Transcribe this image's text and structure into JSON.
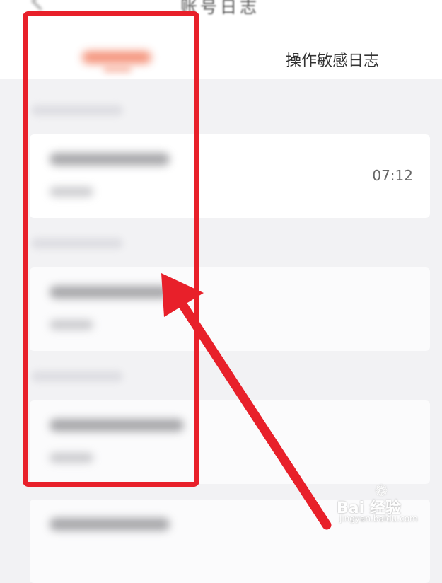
{
  "header": {
    "title": "账号日志",
    "tabs": [
      {
        "label": "",
        "active": true
      },
      {
        "label": "操作敏感日志",
        "active": false
      }
    ]
  },
  "entries": [
    {
      "time": "07:12"
    },
    {
      "time": ""
    },
    {
      "time": ""
    },
    {
      "time": ""
    }
  ],
  "watermark": {
    "brand": "Bai 经验",
    "url": "jingyan.baidu.com",
    "icon": "paw-icon"
  },
  "colors": {
    "accent": "#f27a5c",
    "annotation": "#e8202a"
  }
}
